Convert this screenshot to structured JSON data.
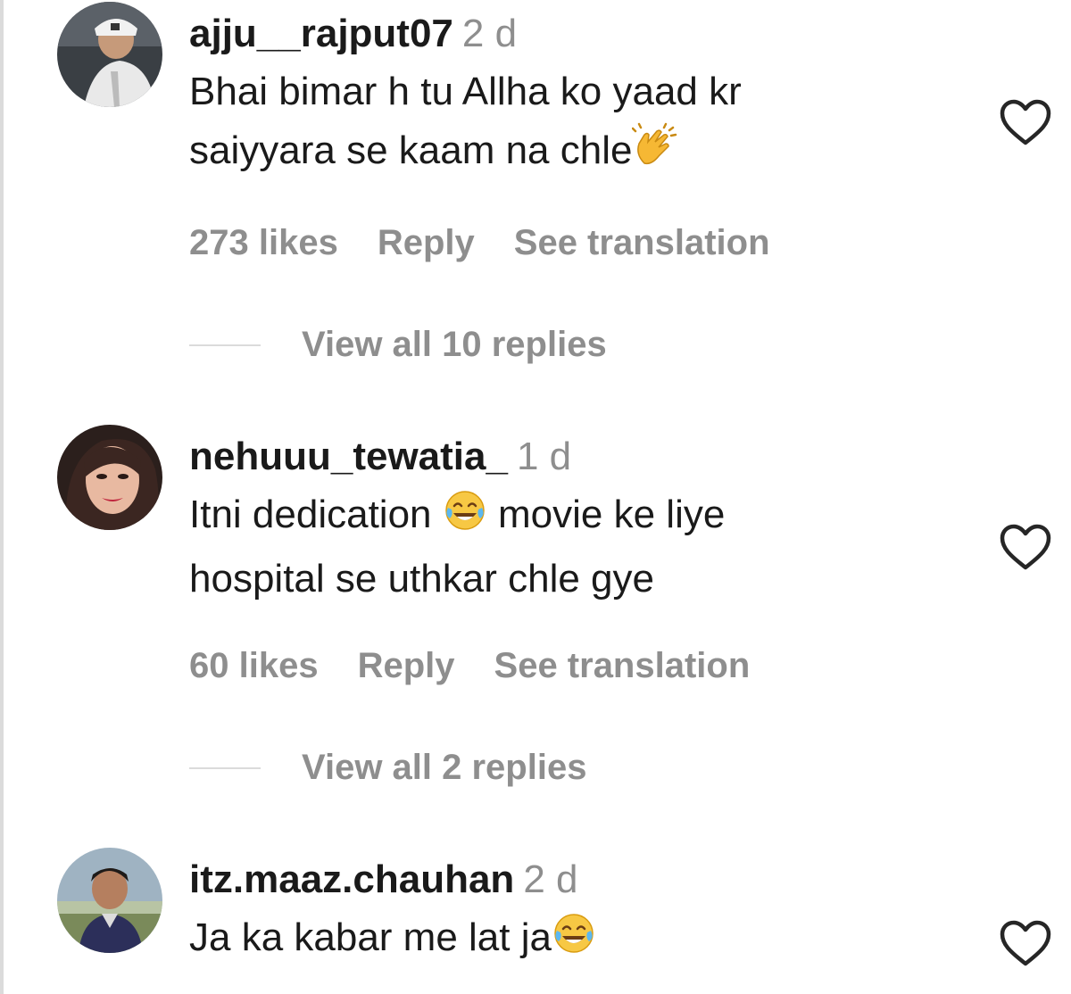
{
  "comments": [
    {
      "username": "ajju__rajput07",
      "time": "2 d",
      "text_line1": "Bhai bimar h tu Allha ko yaad kr",
      "text_line2": "saiyyara se kaam na chle",
      "emoji": "clapping-hands-emoji",
      "likes": "273 likes",
      "reply": "Reply",
      "see_translation": "See translation",
      "view_replies": "View all 10 replies",
      "avatar": "user-avatar-photo"
    },
    {
      "username": "nehuuu_tewatia_",
      "time": "1 d",
      "text_part1": "Itni dedication",
      "text_part2": "movie ke liye",
      "text_line2": "hospital se uthkar chle gye",
      "emoji": "face-with-tears-of-joy-emoji",
      "likes": "60 likes",
      "reply": "Reply",
      "see_translation": "See translation",
      "view_replies": "View all 2 replies",
      "avatar": "user-avatar-photo"
    },
    {
      "username": "itz.maaz.chauhan",
      "time": "2 d",
      "text_line1": "Ja ka kabar me lat ja",
      "emoji": "face-with-tears-of-joy-emoji",
      "avatar": "user-avatar-photo"
    }
  ],
  "icons": {
    "like": "heart-outline-icon"
  },
  "colors": {
    "primary_text": "#1a1a1a",
    "secondary_text": "#8e8e8e",
    "divider": "#dbdbdb",
    "background": "#ffffff"
  }
}
